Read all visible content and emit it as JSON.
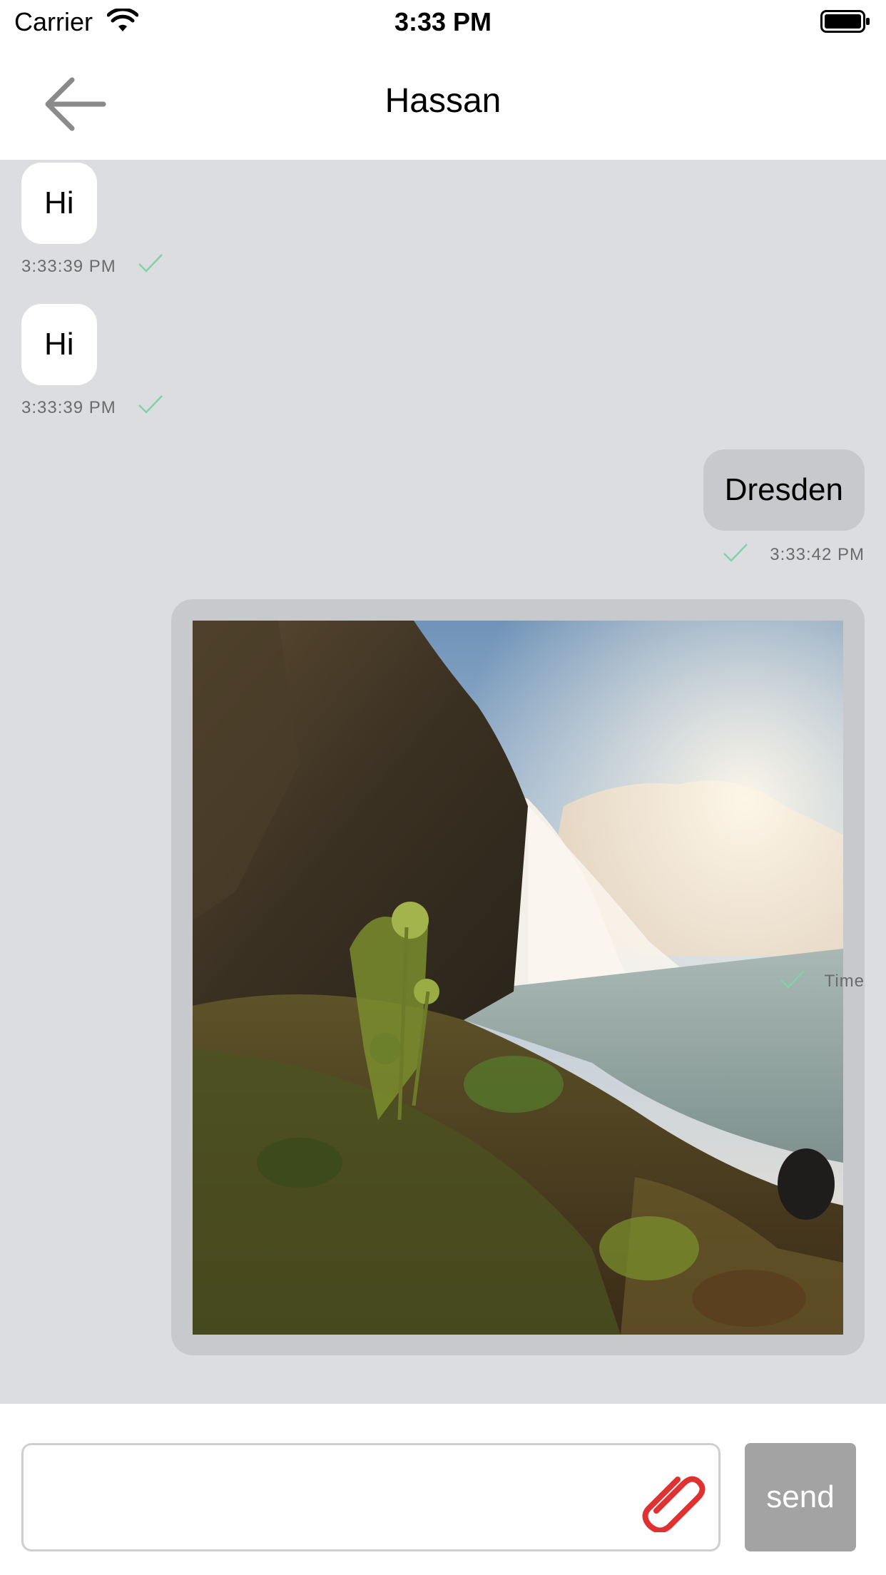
{
  "status_bar": {
    "carrier": "Carrier",
    "time": "3:33 PM"
  },
  "nav": {
    "title": "Hassan"
  },
  "messages": [
    {
      "direction": "incoming",
      "text": "Hi",
      "time": "3:33:39 PM",
      "status": "sent"
    },
    {
      "direction": "incoming",
      "text": "Hi",
      "time": "3:33:39 PM",
      "status": "sent"
    },
    {
      "direction": "outgoing",
      "text": "Dresden",
      "time": "3:33:42 PM",
      "status": "sent"
    },
    {
      "direction": "outgoing",
      "type": "image",
      "time": "Time",
      "status": "sent"
    }
  ],
  "composer": {
    "text": "",
    "send_label": "send"
  },
  "colors": {
    "chat_bg": "#dcdde0",
    "check": "#7fd3a7",
    "attach": "#e03131",
    "send_bg": "#a3a3a3"
  },
  "icons": {
    "back": "arrow-left-icon",
    "attach": "paperclip-icon",
    "check": "checkmark-icon"
  }
}
